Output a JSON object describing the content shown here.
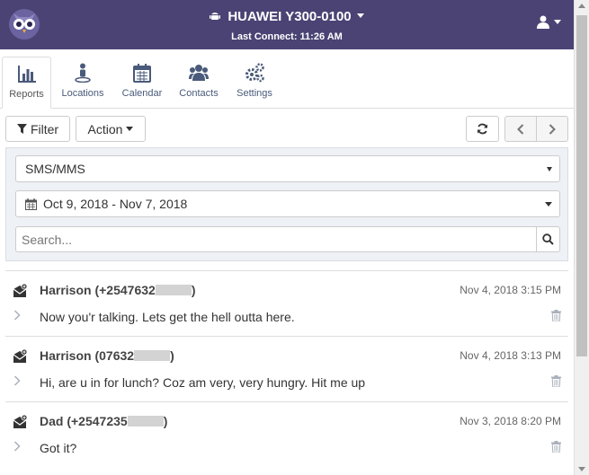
{
  "header": {
    "device_name": "HUAWEI Y300-0100",
    "last_connect": "Last Connect: 11:26 AM",
    "bg_color": "#4a4374"
  },
  "tabs": [
    {
      "label": "Reports",
      "icon": "bar-chart-icon",
      "active": true
    },
    {
      "label": "Locations",
      "icon": "person-pin-icon",
      "active": false
    },
    {
      "label": "Calendar",
      "icon": "calendar-icon",
      "active": false
    },
    {
      "label": "Contacts",
      "icon": "users-icon",
      "active": false
    },
    {
      "label": "Settings",
      "icon": "gears-icon",
      "active": false
    }
  ],
  "toolbar": {
    "filter_label": "Filter",
    "action_label": "Action"
  },
  "filters": {
    "type_value": "SMS/MMS",
    "date_range": "Oct 9, 2018 - Nov 7, 2018",
    "search_placeholder": "Search..."
  },
  "messages": [
    {
      "contact": "Harrison (+2547632",
      "contact_end": ")",
      "time": "Nov 4, 2018 3:15 PM",
      "text": "Now you'r talking. Lets get the hell outta here."
    },
    {
      "contact": "Harrison (07632",
      "contact_end": ")",
      "time": "Nov 4, 2018 3:13 PM",
      "text": "Hi, are u in for lunch? Coz am very, very hungry. Hit me up"
    },
    {
      "contact": "Dad (+2547235",
      "contact_end": ")",
      "time": "Nov 3, 2018 8:20 PM",
      "text": "Got it?"
    }
  ]
}
